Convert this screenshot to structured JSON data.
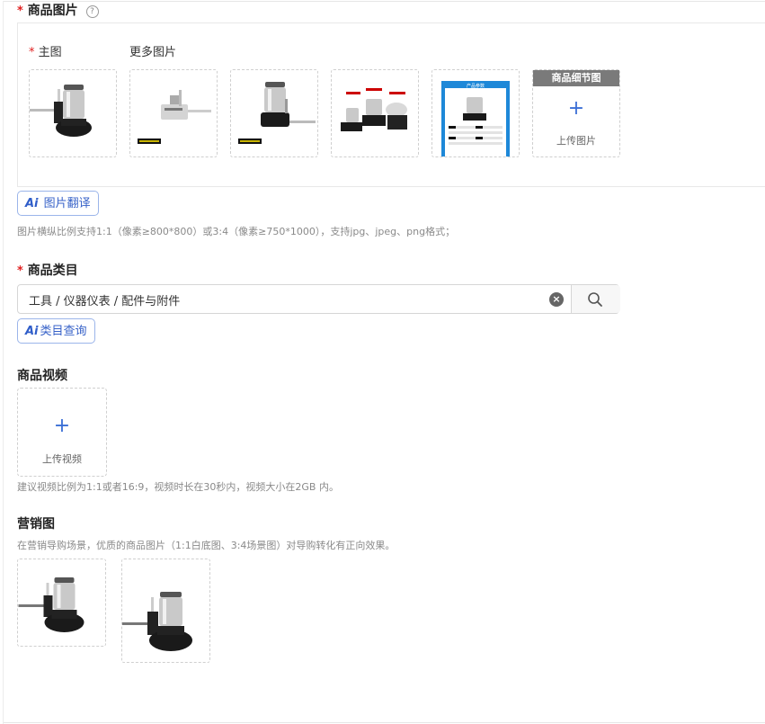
{
  "product_images": {
    "label": "商品图片",
    "required_mark": "*",
    "help_icon": "?",
    "main_label": "主图",
    "more_label": "更多图片",
    "thumbnails": [
      {
        "caption": ""
      },
      {
        "caption": ""
      },
      {
        "caption": ""
      },
      {
        "caption": ""
      },
      {
        "caption": "产品参数"
      }
    ],
    "detail_tile": {
      "banner": "商品细节图",
      "plus": "+",
      "upload_text": "上传图片"
    },
    "ai_translate": {
      "ai": "Ai",
      "label": "图片翻译"
    },
    "hint": "图片横纵比例支持1:1（像素≥800*800）或3:4（像素≥750*1000），支持jpg、jpeg、png格式；"
  },
  "category": {
    "label": "商品类目",
    "required_mark": "*",
    "value": "工具 / 仪器仪表 / 配件与附件",
    "clear_icon": "×",
    "ai_query": {
      "ai": "Ai",
      "label": "类目查询"
    }
  },
  "video": {
    "label": "商品视频",
    "plus": "+",
    "upload_text": "上传视频",
    "hint": "建议视频比例为1:1或者16:9，视频时长在30秒内，视频大小在2GB 内。"
  },
  "marketing": {
    "label": "营销图",
    "hint": "在营销导购场景，优质的商品图片（1:1白底图、3:4场景图）对导购转化有正向效果。"
  },
  "colors": {
    "accent": "#3762c8",
    "required": "#e02020",
    "banner": "#7a7a7a"
  }
}
